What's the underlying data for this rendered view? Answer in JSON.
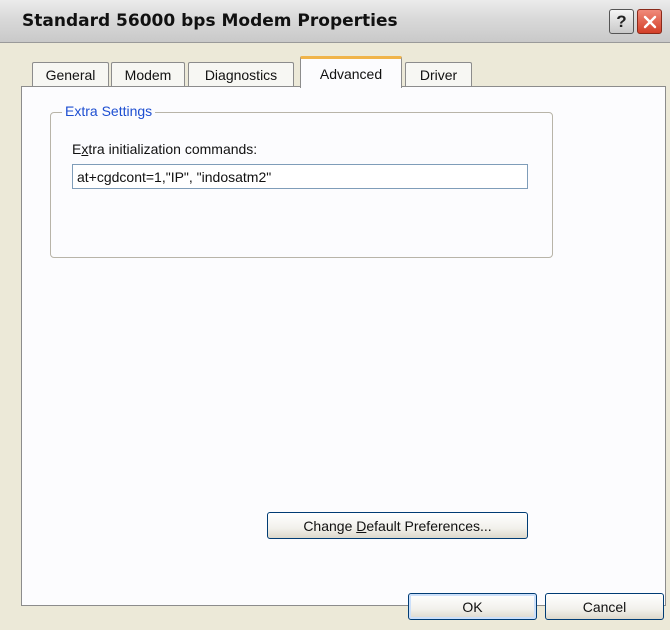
{
  "window": {
    "title": "Standard 56000 bps Modem Properties",
    "help_glyph": "?",
    "close_glyph": "✕"
  },
  "tabs": [
    {
      "label": "General",
      "active": false
    },
    {
      "label": "Modem",
      "active": false
    },
    {
      "label": "Diagnostics",
      "active": false
    },
    {
      "label": "Advanced",
      "active": true
    },
    {
      "label": "Driver",
      "active": false
    }
  ],
  "extra_settings": {
    "group_label": "Extra Settings",
    "field_label_mnemonic": "x",
    "field_label_prefix": "E",
    "field_label_suffix": "tra initialization commands:",
    "value": "at+cgdcont=1,\"IP\", \"indosatm2\""
  },
  "buttons": {
    "change_prefix": "Change ",
    "change_mnemonic": "D",
    "change_suffix": "efault Preferences...",
    "ok": "OK",
    "cancel": "Cancel"
  },
  "colors": {
    "accent_tab": "#f0b44a",
    "group_label": "#1e4fd1",
    "close_button": "#d33f28"
  }
}
